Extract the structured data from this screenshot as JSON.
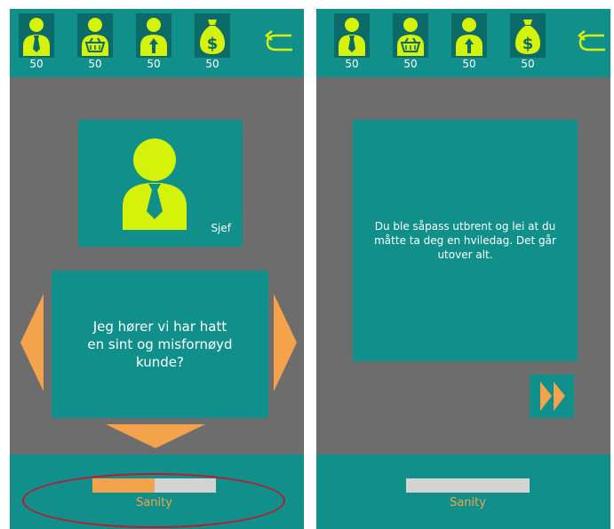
{
  "colors": {
    "teal": "#118f8a",
    "dark_teal": "#0c6b68",
    "gray": "#6d6d6d",
    "lime": "#d4f20a",
    "orange": "#f5a24d",
    "light_gray": "#d3d3d3",
    "highlight_red": "#c0172e"
  },
  "left": {
    "stats": [
      {
        "icon": "boss-icon",
        "value": "50"
      },
      {
        "icon": "customer-icon",
        "value": "50"
      },
      {
        "icon": "colleague-icon",
        "value": "50"
      },
      {
        "icon": "money-bag-icon",
        "value": "50"
      }
    ],
    "speaker": "Sjef",
    "dialog": "Jeg hører vi har hatt en sint og misfornøyd kunde?",
    "sanity_label": "Sanity",
    "sanity_level": 0.5
  },
  "right": {
    "stats": [
      {
        "icon": "boss-icon",
        "value": "50"
      },
      {
        "icon": "customer-icon",
        "value": "50"
      },
      {
        "icon": "colleague-icon",
        "value": "50"
      },
      {
        "icon": "money-bag-icon",
        "value": "50"
      }
    ],
    "event_text": "Du ble såpass utbrent og lei at du måtte ta deg en hviledag. Det går utover alt.",
    "sanity_label": "Sanity",
    "sanity_level": 0
  }
}
